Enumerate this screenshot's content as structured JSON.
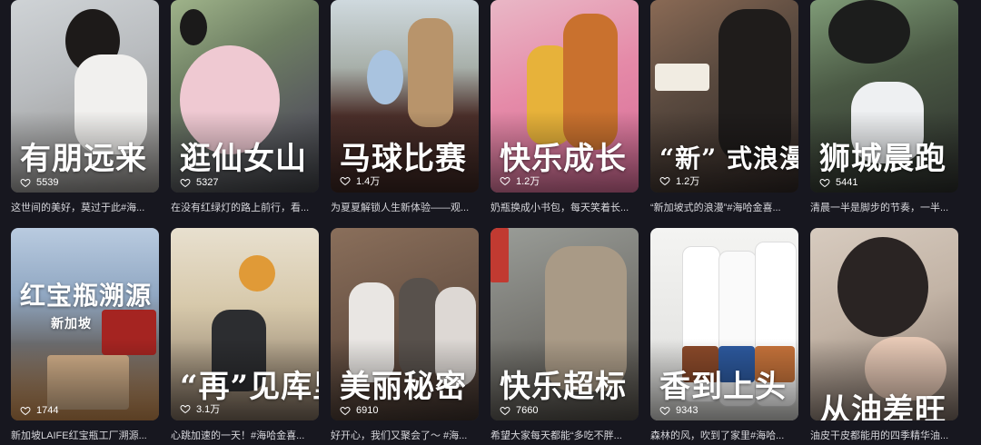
{
  "cards": [
    {
      "overlay": "有朋远来",
      "likes": "5539",
      "caption": "这世间的美好，莫过于此#海..."
    },
    {
      "overlay": "逛仙女山",
      "likes": "5327",
      "caption": "在没有红绿灯的路上前行，看..."
    },
    {
      "overlay": "马球比赛",
      "likes": "1.4万",
      "caption": "为夏夏解锁人生新体验——观..."
    },
    {
      "overlay": "快乐成长",
      "likes": "1.2万",
      "caption": "奶瓶换成小书包，每天笑着长..."
    },
    {
      "overlay": "“新” 式浪漫",
      "likes": "1.2万",
      "caption": "“新加坡式的浪漫”#海哈金喜..."
    },
    {
      "overlay": "狮城晨跑",
      "likes": "5441",
      "caption": "清晨一半是脚步的节奏，一半..."
    },
    {
      "overlay": "红宝瓶溯源",
      "sub_overlay": "新加坡",
      "likes": "1744",
      "caption": "新加坡LAIFE红宝瓶工厂溯源..."
    },
    {
      "overlay": "“再”见库里",
      "likes": "3.1万",
      "caption": "心跳加速的一天！#海哈金喜..."
    },
    {
      "overlay": "美丽秘密",
      "likes": "6910",
      "caption": "好开心，我们又聚会了～ #海..."
    },
    {
      "overlay": "快乐超标",
      "likes": "7660",
      "caption": "希望大家每天都能“多吃不胖..."
    },
    {
      "overlay": "香到上头",
      "likes": "9343",
      "caption": "森林的风，吹到了家里#海哈..."
    },
    {
      "overlay": "从油差旺",
      "likes": "",
      "caption": "油皮干皮都能用的四季精华油..."
    }
  ]
}
